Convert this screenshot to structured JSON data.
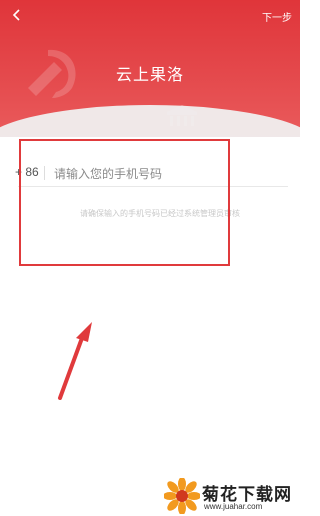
{
  "header": {
    "back_icon": "chevron-left",
    "title": "云上果洛",
    "next_label": "下一步",
    "colors": {
      "primary": "#e0353a"
    }
  },
  "phone": {
    "country_code": "+ 86",
    "placeholder": "请输入您的手机号码",
    "hint": "请确保输入的手机号码已经过系统管理员审核"
  },
  "watermark": {
    "name": "菊花下载网",
    "url": "www.juahar.com"
  }
}
